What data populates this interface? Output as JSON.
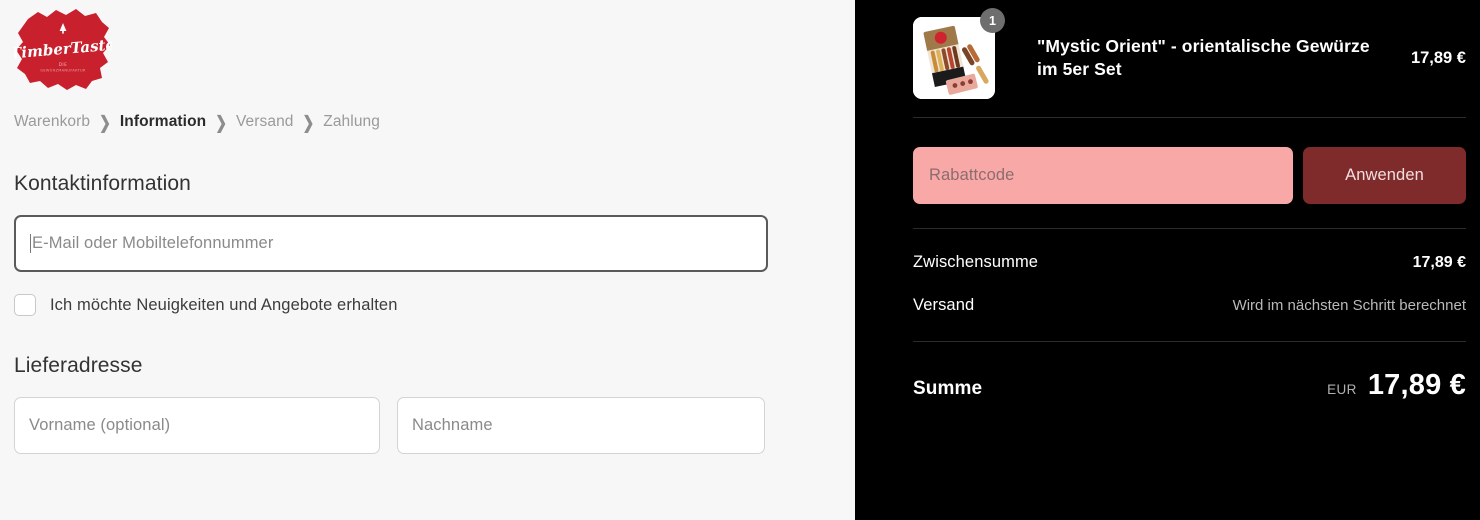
{
  "brand": {
    "logo_name": "TimberTaste",
    "logo_tagline": "DIE GEWÜRZMANUFAKTUR",
    "logo_color": "#c8202d"
  },
  "breadcrumb": {
    "separator_icon": "chevron-right-icon",
    "items": [
      {
        "label": "Warenkorb",
        "active": false
      },
      {
        "label": "Information",
        "active": true
      },
      {
        "label": "Versand",
        "active": false
      },
      {
        "label": "Zahlung",
        "active": false
      }
    ]
  },
  "contact": {
    "heading": "Kontaktinformation",
    "email": {
      "value": "",
      "placeholder": "E-Mail oder Mobiltelefonnummer",
      "focused": true
    },
    "newsletter": {
      "label": "Ich möchte Neuigkeiten und Angebote erhalten",
      "checked": false
    }
  },
  "shipping_address": {
    "heading": "Lieferadresse",
    "first_name": {
      "value": "",
      "placeholder": "Vorname (optional)"
    },
    "last_name": {
      "value": "",
      "placeholder": "Nachname"
    }
  },
  "order_summary": {
    "item": {
      "name": "\"Mystic Orient\" - orientalische Gewürze im 5er Set",
      "quantity": "1",
      "price": "17,89 €",
      "thumbnail_icon": "spice-gift-box-image"
    },
    "discount": {
      "placeholder": "Rabattcode",
      "value": "",
      "apply_label": "Anwenden",
      "input_color": "#f9a8a8",
      "button_color": "#7f2b2b"
    },
    "rows": [
      {
        "label": "Zwischensumme",
        "value": "17,89 €",
        "muted": false
      },
      {
        "label": "Versand",
        "value": "Wird im nächsten Schritt berechnet",
        "muted": true
      }
    ],
    "total": {
      "label": "Summe",
      "currency": "EUR",
      "amount": "17,89 €"
    }
  }
}
